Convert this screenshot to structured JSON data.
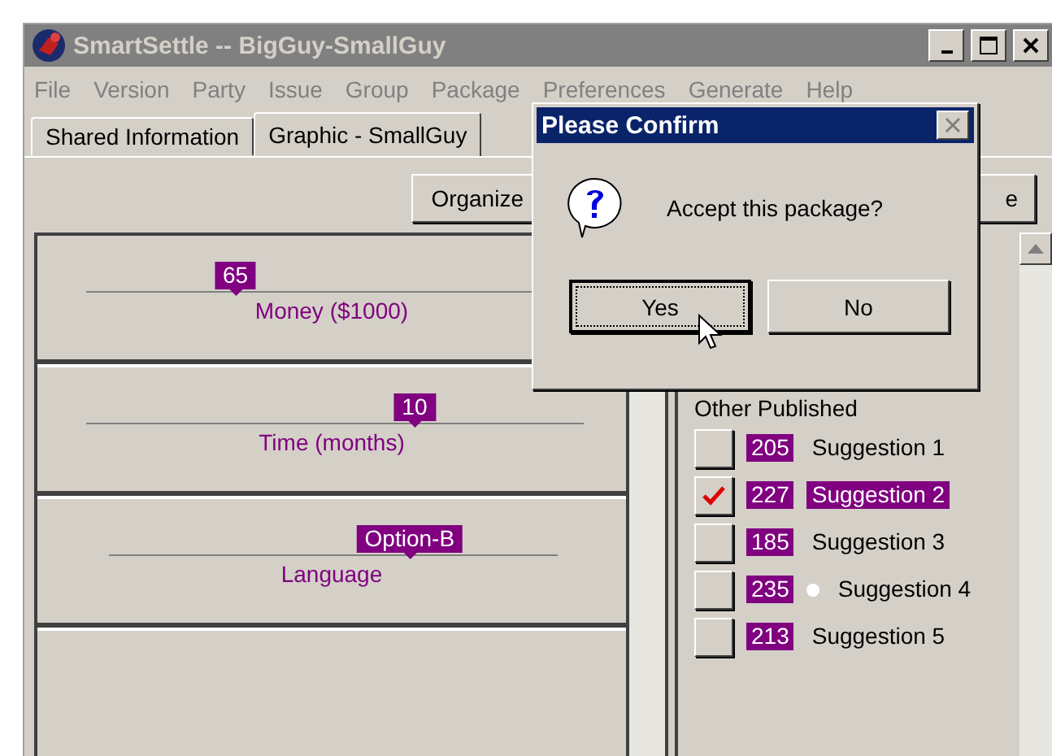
{
  "window": {
    "title": "SmartSettle -- BigGuy-SmallGuy",
    "active": false
  },
  "menu": [
    "File",
    "Version",
    "Party",
    "Issue",
    "Group",
    "Package",
    "Preferences",
    "Generate",
    "Help"
  ],
  "tabs": [
    {
      "label": "Shared Information",
      "selected": false
    },
    {
      "label": "Graphic - SmallGuy",
      "selected": true
    }
  ],
  "toolbar": [
    "Organize",
    "e"
  ],
  "issues": [
    {
      "name": "Money ($1000)",
      "value": "65",
      "level": 0.3
    },
    {
      "name": "Time (months)",
      "value": "10",
      "level": 0.66
    },
    {
      "name": "Language",
      "value": "Option-B",
      "level": 0.67
    }
  ],
  "published": {
    "heading": "Other Published",
    "items": [
      {
        "score": "205",
        "label": "Suggestion 1",
        "checked": false,
        "selected": false,
        "dot": false
      },
      {
        "score": "227",
        "label": "Suggestion 2",
        "checked": true,
        "selected": true,
        "dot": false
      },
      {
        "score": "185",
        "label": "Suggestion 3",
        "checked": false,
        "selected": false,
        "dot": false
      },
      {
        "score": "235",
        "label": "Suggestion 4",
        "checked": false,
        "selected": false,
        "dot": true
      },
      {
        "score": "213",
        "label": "Suggestion 5",
        "checked": false,
        "selected": false,
        "dot": false
      }
    ]
  },
  "dialog": {
    "title": "Please Confirm",
    "message": "Accept this package?",
    "buttons": [
      {
        "label": "Yes",
        "focused": true
      },
      {
        "label": "No",
        "focused": false
      }
    ]
  }
}
